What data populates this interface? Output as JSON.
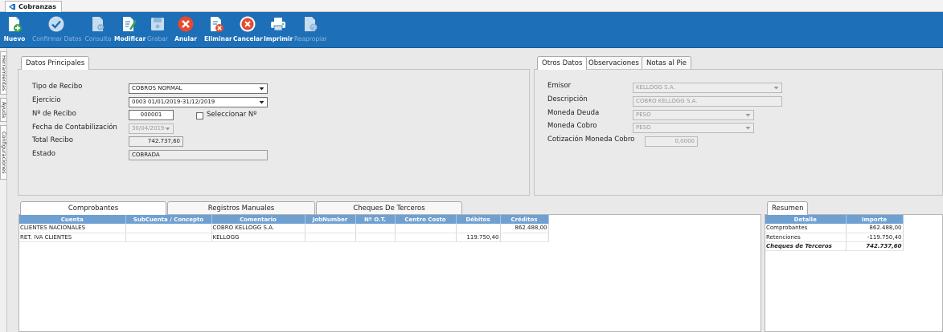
{
  "window": {
    "title": "Cobranzas"
  },
  "toolbar": {
    "buttons": [
      {
        "id": "nuevo",
        "label": "Nuevo",
        "icon": "new-doc-icon",
        "enabled": true
      },
      {
        "id": "confirmar",
        "label": "Confirmar Datos",
        "icon": "check-icon",
        "enabled": false
      },
      {
        "id": "consulta",
        "label": "Consulta",
        "icon": "search-doc-icon",
        "enabled": false
      },
      {
        "id": "modificar",
        "label": "Modificar",
        "icon": "edit-doc-icon",
        "enabled": true
      },
      {
        "id": "grabar",
        "label": "Grabar",
        "icon": "save-icon",
        "enabled": false
      },
      {
        "id": "anular",
        "label": "Anular",
        "icon": "cancel-x-icon",
        "enabled": true
      },
      {
        "id": "eliminar",
        "label": "Eliminar",
        "icon": "delete-doc-icon",
        "enabled": true
      },
      {
        "id": "cancelar",
        "label": "Cancelar",
        "icon": "cancel-circle-icon",
        "enabled": true
      },
      {
        "id": "imprimir",
        "label": "Imprimir",
        "icon": "printer-icon",
        "enabled": true
      },
      {
        "id": "reapropiar",
        "label": "Reapropiar",
        "icon": "reassign-doc-icon",
        "enabled": false
      }
    ]
  },
  "side_tabs": [
    "Herramientas",
    "Ayuda",
    "Configuraciones"
  ],
  "datos_principales": {
    "tab": "Datos Principales",
    "tipo_recibo": {
      "label": "Tipo de Recibo",
      "value": "COBROS NORMAL"
    },
    "ejercicio": {
      "label": "Ejercicio",
      "value": "0003 01/01/2019-31/12/2019"
    },
    "nro_recibo": {
      "label": "Nº de Recibo",
      "value": "000001"
    },
    "seleccionar": {
      "label": "Seleccionar Nº",
      "checked": false
    },
    "fecha": {
      "label": "Fecha de Contabilización",
      "value": "30/04/2019"
    },
    "total": {
      "label": "Total Recibo",
      "value": "742.737,60"
    },
    "estado": {
      "label": "Estado",
      "value": "COBRADA"
    }
  },
  "otros_datos": {
    "tabs": [
      "Otros Datos",
      "Observaciones",
      "Notas al Pie"
    ],
    "emisor": {
      "label": "Emisor",
      "value": "KELLOGG S.A."
    },
    "descripcion": {
      "label": "Descripción",
      "value": "COBRO KELLOGG S.A."
    },
    "moneda_deuda": {
      "label": "Moneda Deuda",
      "value": "PESO"
    },
    "moneda_cobro": {
      "label": "Moneda Cobro",
      "value": "PESO"
    },
    "cotizacion": {
      "label": "Cotización Moneda Cobro",
      "value": "0,0000"
    }
  },
  "detalle": {
    "tabs": [
      "Comprobantes",
      "Registros Manuales",
      "Cheques De Terceros"
    ],
    "columns": [
      "Cuenta",
      "SubCuenta / Concepto",
      "Comentario",
      "JobNumber",
      "Nº O.T.",
      "Centro Costo",
      "Débitos",
      "Créditos"
    ],
    "rows": [
      [
        "CLIENTES NACIONALES",
        "",
        "COBRO KELLOGG S.A.",
        "",
        "",
        "",
        "",
        "862.488,00"
      ],
      [
        "RET. IVA CLIENTES",
        "",
        "KELLOGG",
        "",
        "",
        "",
        "119.750,40",
        ""
      ]
    ]
  },
  "resumen": {
    "tab": "Resumen",
    "columns": [
      "Detalle",
      "Importe"
    ],
    "rows": [
      {
        "detalle": "Comprobantes",
        "importe": "862.488,00",
        "bold": false
      },
      {
        "detalle": "Retenciones",
        "importe": "-119.750,40",
        "bold": false
      },
      {
        "detalle": "Cheques de Terceros",
        "importe": "742.737,60",
        "bold": true
      }
    ]
  },
  "colors": {
    "toolbar": "#1d6fb8",
    "grid_header": "#6fa0d2",
    "danger": "#e84a2f"
  }
}
